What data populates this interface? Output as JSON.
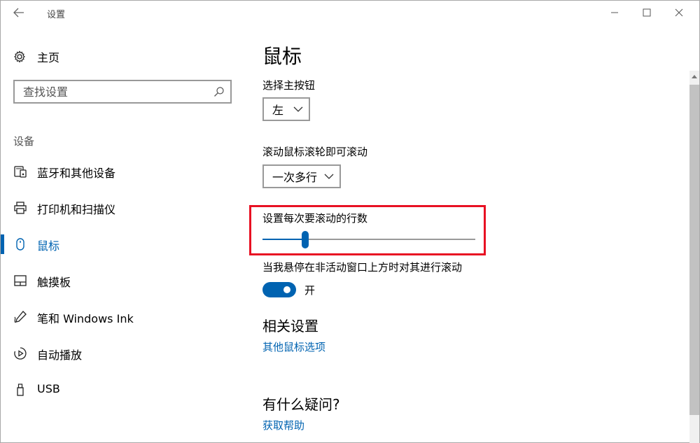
{
  "window": {
    "title": "设置",
    "controls": [
      "minimize-icon",
      "maximize-icon",
      "close-icon"
    ]
  },
  "sidebar": {
    "home_label": "主页",
    "search_placeholder": "查找设置",
    "section_label": "设备",
    "items": [
      {
        "label": "蓝牙和其他设备",
        "icon": "bluetooth-devices-icon",
        "selected": false
      },
      {
        "label": "打印机和扫描仪",
        "icon": "printer-icon",
        "selected": false
      },
      {
        "label": "鼠标",
        "icon": "mouse-icon",
        "selected": true
      },
      {
        "label": "触摸板",
        "icon": "touchpad-icon",
        "selected": false
      },
      {
        "label": "笔和 Windows Ink",
        "icon": "pen-icon",
        "selected": false
      },
      {
        "label": "自动播放",
        "icon": "autoplay-icon",
        "selected": false
      },
      {
        "label": "USB",
        "icon": "usb-icon",
        "selected": false
      }
    ]
  },
  "main": {
    "title": "鼠标",
    "primary_button": {
      "label": "选择主按钮",
      "value": "左"
    },
    "scroll_mode": {
      "label": "滚动鼠标滚轮即可滚动",
      "value": "一次多行"
    },
    "scroll_lines": {
      "label": "设置每次要滚动的行数",
      "fraction": 0.2
    },
    "inactive_scroll": {
      "label": "当我悬停在非活动窗口上方时对其进行滚动",
      "state": "开",
      "on": true
    },
    "related": {
      "heading": "相关设置",
      "link": "其他鼠标选项"
    },
    "help": {
      "heading": "有什么疑问?",
      "link": "获取帮助"
    }
  },
  "colors": {
    "accent": "#0063b1",
    "highlight_box": "#e81123"
  }
}
